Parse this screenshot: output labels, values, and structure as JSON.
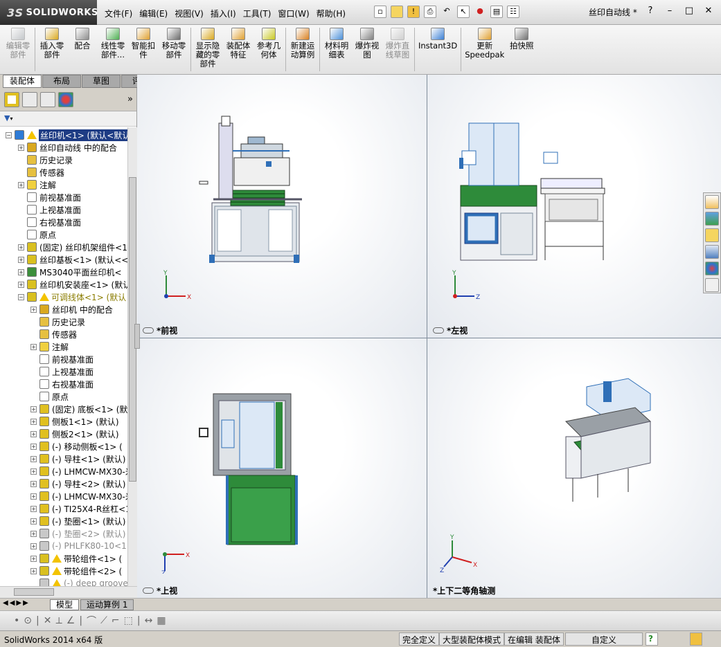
{
  "app": {
    "brand_prefix": "3S",
    "brand": "SOLIDWORKS",
    "document_title": "丝印自动线 *"
  },
  "menu": [
    "文件(F)",
    "编辑(E)",
    "视图(V)",
    "插入(I)",
    "工具(T)",
    "窗口(W)",
    "帮助(H)"
  ],
  "commands": [
    {
      "label": "编辑零\n部件",
      "disabled": true,
      "color": "#9aa0a6"
    },
    {
      "label": "插入零\n部件",
      "disabled": false,
      "color": "#d9a81f"
    },
    {
      "label": "配合",
      "disabled": false,
      "color": "#8c8c8c"
    },
    {
      "label": "线性零\n部件...",
      "disabled": false,
      "color": "#4caf50"
    },
    {
      "label": "智能扣\n件",
      "disabled": false,
      "color": "#e0a030"
    },
    {
      "label": "移动零\n部件",
      "disabled": false,
      "color": "#6a6a6a"
    },
    {
      "label": "显示隐\n藏的零\n部件",
      "disabled": false,
      "color": "#d9a81f"
    },
    {
      "label": "装配体\n特征",
      "disabled": false,
      "color": "#e0a030"
    },
    {
      "label": "参考几\n何体",
      "disabled": false,
      "color": "#c8c820"
    },
    {
      "label": "新建运\n动算例",
      "disabled": false,
      "color": "#d98020"
    },
    {
      "label": "材料明\n细表",
      "disabled": false,
      "color": "#4a8fd8"
    },
    {
      "label": "爆炸视\n图",
      "disabled": false,
      "color": "#808080"
    },
    {
      "label": "爆炸直\n线草图",
      "disabled": true,
      "color": "#b0b0b0"
    },
    {
      "label": "Instant3D",
      "disabled": false,
      "color": "#3b7fd4"
    },
    {
      "label": "更新\nSpeedpak",
      "disabled": false,
      "color": "#e0a030"
    },
    {
      "label": "拍快照",
      "disabled": false,
      "color": "#707070"
    }
  ],
  "command_tabs": [
    "装配体",
    "布局",
    "草图",
    "评估"
  ],
  "tree": [
    {
      "text": "丝印机<1> (默认<默认",
      "level": 0,
      "exp": "-",
      "icon": "#2e7bd6",
      "warn": true,
      "sel": true
    },
    {
      "text": "丝印自动线 中的配合",
      "level": 1,
      "exp": "+",
      "icon": "#d9a81f"
    },
    {
      "text": "历史记录",
      "level": 1,
      "exp": "",
      "icon": "#e6c040"
    },
    {
      "text": "传感器",
      "level": 1,
      "exp": "",
      "icon": "#e6c040"
    },
    {
      "text": "注解",
      "level": 1,
      "exp": "+",
      "icon": "#f0d040"
    },
    {
      "text": "前视基准面",
      "level": 1,
      "exp": "",
      "icon": "#ffffff"
    },
    {
      "text": "上视基准面",
      "level": 1,
      "exp": "",
      "icon": "#ffffff"
    },
    {
      "text": "右视基准面",
      "level": 1,
      "exp": "",
      "icon": "#ffffff"
    },
    {
      "text": "原点",
      "level": 1,
      "exp": "",
      "icon": "#ffffff"
    },
    {
      "text": "(固定) 丝印机架组件<1",
      "level": 1,
      "exp": "+",
      "icon": "#d9c020"
    },
    {
      "text": "丝印基板<1> (默认<<!",
      "level": 1,
      "exp": "+",
      "icon": "#d9c020"
    },
    {
      "text": "MS3040平面丝印机<",
      "level": 1,
      "exp": "+",
      "icon": "#3c8f3c"
    },
    {
      "text": "丝印机安装座<1> (默认",
      "level": 1,
      "exp": "+",
      "icon": "#d9c020"
    },
    {
      "text": "可调线体<1> (默认",
      "level": 1,
      "exp": "-",
      "icon": "#d9c020",
      "warn": true,
      "olive": true
    },
    {
      "text": "丝印机 中的配合",
      "level": 2,
      "exp": "+",
      "icon": "#d9a81f"
    },
    {
      "text": "历史记录",
      "level": 2,
      "exp": "",
      "icon": "#e6c040"
    },
    {
      "text": "传感器",
      "level": 2,
      "exp": "",
      "icon": "#e6c040"
    },
    {
      "text": "注解",
      "level": 2,
      "exp": "+",
      "icon": "#f0d040"
    },
    {
      "text": "前视基准面",
      "level": 2,
      "exp": "",
      "icon": "#ffffff"
    },
    {
      "text": "上视基准面",
      "level": 2,
      "exp": "",
      "icon": "#ffffff"
    },
    {
      "text": "右视基准面",
      "level": 2,
      "exp": "",
      "icon": "#ffffff"
    },
    {
      "text": "原点",
      "level": 2,
      "exp": "",
      "icon": "#ffffff"
    },
    {
      "text": "(固定) 底板<1> (默",
      "level": 2,
      "exp": "+",
      "icon": "#e0c020"
    },
    {
      "text": "侧板1<1> (默认)",
      "level": 2,
      "exp": "+",
      "icon": "#e0c020"
    },
    {
      "text": "侧板2<1> (默认)",
      "level": 2,
      "exp": "+",
      "icon": "#e0c020"
    },
    {
      "text": "(-) 移动侧板<1> (",
      "level": 2,
      "exp": "+",
      "icon": "#e0c020"
    },
    {
      "text": "(-) 导柱<1> (默认)",
      "level": 2,
      "exp": "+",
      "icon": "#e0c020"
    },
    {
      "text": "(-) LHMCW-MX30-米",
      "level": 2,
      "exp": "+",
      "icon": "#e0c020"
    },
    {
      "text": "(-) 导柱<2> (默认)",
      "level": 2,
      "exp": "+",
      "icon": "#e0c020"
    },
    {
      "text": "(-) LHMCW-MX30-米",
      "level": 2,
      "exp": "+",
      "icon": "#e0c020"
    },
    {
      "text": "(-) TI25X4-R丝杠<1",
      "level": 2,
      "exp": "+",
      "icon": "#e0c020"
    },
    {
      "text": "(-) 垫圈<1> (默认)",
      "level": 2,
      "exp": "+",
      "icon": "#e0c020"
    },
    {
      "text": "(-) 垫圈<2> (默认)",
      "level": 2,
      "exp": "+",
      "icon": "#c8c8c8",
      "grey": true
    },
    {
      "text": "(-) PHLFK80-10<1>",
      "level": 2,
      "exp": "+",
      "icon": "#c8c8c8",
      "grey": true
    },
    {
      "text": "带轮组件<1> (",
      "level": 2,
      "exp": "+",
      "icon": "#d9c020",
      "warn": true
    },
    {
      "text": "带轮组件<2> (",
      "level": 2,
      "exp": "+",
      "icon": "#d9c020",
      "warn": true
    },
    {
      "text": "(-) deep groove b",
      "level": 2,
      "exp": "",
      "icon": "#c8c8c8",
      "warn": true,
      "grey": true
    }
  ],
  "viewports": [
    {
      "label": "*前视",
      "name": "viewport-front"
    },
    {
      "label": "*左视",
      "name": "viewport-left"
    },
    {
      "label": "*上视",
      "name": "viewport-top"
    },
    {
      "label": "*上下二等角轴测",
      "name": "viewport-isometric"
    }
  ],
  "axes": {
    "x": "X",
    "y": "Y",
    "z": "Z"
  },
  "model_tabs": [
    "模型",
    "运动算例 1"
  ],
  "status": {
    "product": "SolidWorks 2014 x64 版",
    "definition": "完全定义",
    "large_assembly": "大型装配体模式",
    "editing": "在编辑 装配体",
    "units": "自定义"
  },
  "colors": {
    "accent_blue": "#1e3c84",
    "machine_green": "#2e8b3a",
    "machine_blue": "#2f6fb7",
    "viewport_border": "#7f8c9a"
  }
}
